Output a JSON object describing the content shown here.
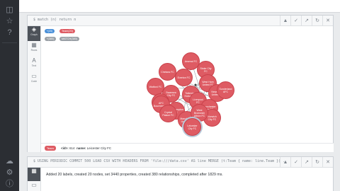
{
  "icons": {
    "database": "database-icon",
    "star": "star-icon",
    "help": "help-icon",
    "cloud": "cloud-icon",
    "settings": "gear-icon",
    "about": "info-icon"
  },
  "frame1": {
    "command": "$ match (n) return n",
    "header_buttons": [
      "pin-icon",
      "expand-icon",
      "collapse-icon",
      "refresh-icon",
      "close-icon"
    ],
    "views": [
      {
        "id": "graph",
        "label": "Graph",
        "icon": "graph-icon",
        "active": true
      },
      {
        "id": "rows",
        "label": "Rows",
        "icon": "table-icon",
        "active": false
      },
      {
        "id": "text",
        "label": "Text",
        "icon": "text-icon",
        "active": false
      },
      {
        "id": "code",
        "label": "Code",
        "icon": "code-icon",
        "active": false
      }
    ],
    "pill_row1": {
      "count": "*(20)",
      "label": "Team(20)"
    },
    "pill_row2": {
      "count": "*(380)",
      "label": "MATCH(380)"
    },
    "nodes": [
      "Arsenal FC",
      "Leicester City FC",
      "Chelsea FC",
      "Everton FC",
      "Stoke City FC",
      "Watford FC",
      "West Ham United FC",
      "Swansea City FC",
      "Aston Villa FC",
      "Newcastle United FC",
      "Tottenham Hotspur FC",
      "Liverpool FC",
      "Southampton FC",
      "Manchester City FC",
      "AFC Bournemouth",
      "Manchester United FC",
      "Norwich City FC",
      "Sunderland AFC",
      "West Bromwich Albion FC",
      "Crystal Palace FC"
    ],
    "status": {
      "badge": "Team",
      "id_key": "<id>:",
      "id_value": "614",
      "name_key": "name:",
      "name_value": "Leicester City FC"
    }
  },
  "frame2": {
    "command": "$ USING PERIODIC COMMIT 500 LOAD CSV WITH HEADERS FROM 'file:///data.csv' AS line MERGE (t:Team { name: line.Team }) ...",
    "message": "Added 20 labels, created 20 nodes, set 3440 properties, created 380 relationships, completed after 1829 ms."
  },
  "colors": {
    "node": "#de5b63",
    "accent": "#4a90d9",
    "rail": "#2b2e33"
  }
}
